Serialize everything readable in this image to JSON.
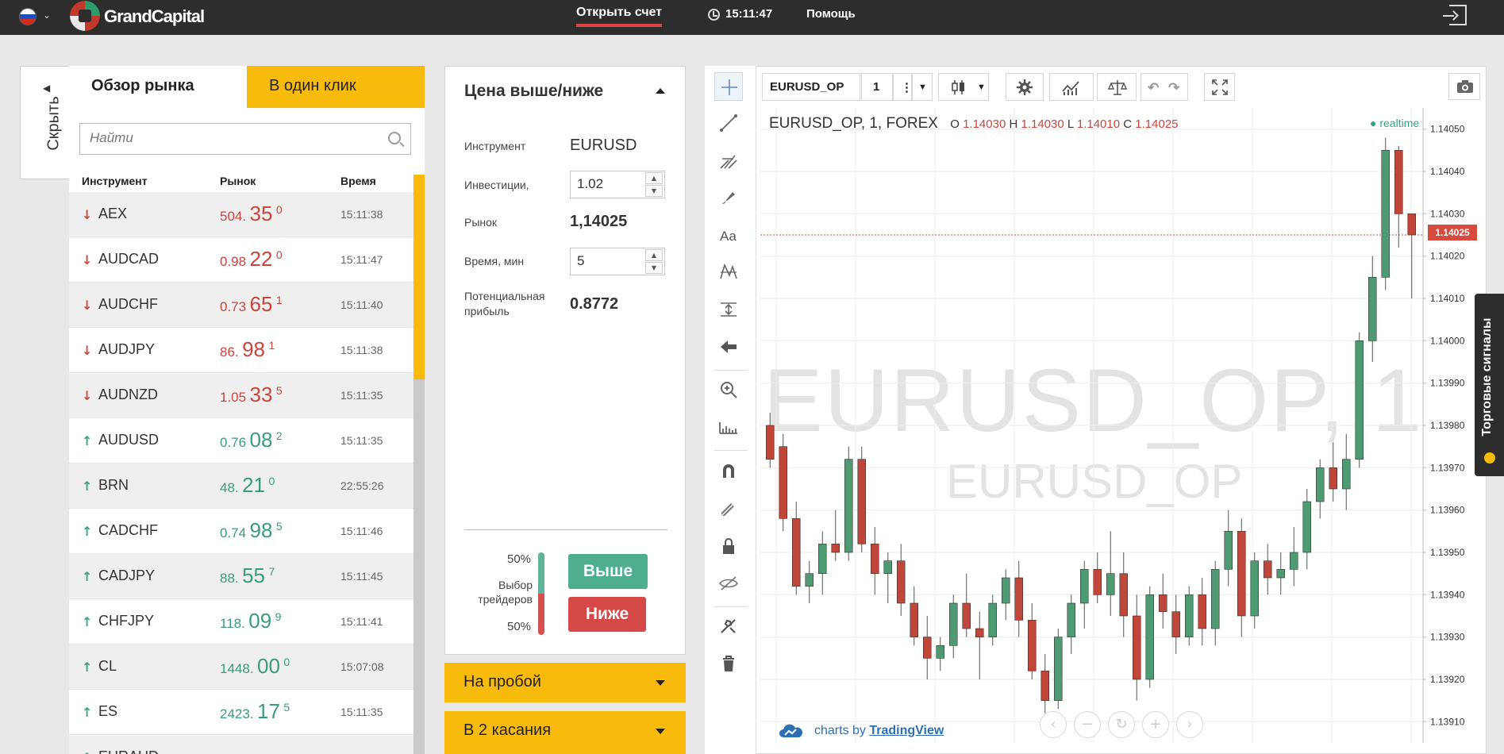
{
  "header": {
    "logo_text": "GrandCapital",
    "open_account": "Открыть счет",
    "time": "15:11:47",
    "help": "Помощь"
  },
  "sidebar_toggle": {
    "label": "Скрыть"
  },
  "market": {
    "tabs": [
      "Обзор рынка",
      "В один клик"
    ],
    "search_placeholder": "Найти",
    "columns": [
      "Инструмент",
      "Рынок",
      "Время"
    ],
    "rows": [
      {
        "symbol": "AEX",
        "dir": "down",
        "p1": "504.",
        "p2": "35",
        "p3": "0",
        "time": "15:11:38"
      },
      {
        "symbol": "AUDCAD",
        "dir": "down",
        "p1": "0.98",
        "p2": "22",
        "p3": "0",
        "time": "15:11:47"
      },
      {
        "symbol": "AUDCHF",
        "dir": "down",
        "p1": "0.73",
        "p2": "65",
        "p3": "1",
        "time": "15:11:40"
      },
      {
        "symbol": "AUDJPY",
        "dir": "down",
        "p1": "86.",
        "p2": "98",
        "p3": "1",
        "time": "15:11:38"
      },
      {
        "symbol": "AUDNZD",
        "dir": "down",
        "p1": "1.05",
        "p2": "33",
        "p3": "5",
        "time": "15:11:35"
      },
      {
        "symbol": "AUDUSD",
        "dir": "up",
        "p1": "0.76",
        "p2": "08",
        "p3": "2",
        "time": "15:11:35"
      },
      {
        "symbol": "BRN",
        "dir": "up",
        "p1": "48.",
        "p2": "21",
        "p3": "0",
        "time": "22:55:26"
      },
      {
        "symbol": "CADCHF",
        "dir": "up",
        "p1": "0.74",
        "p2": "98",
        "p3": "5",
        "time": "15:11:46"
      },
      {
        "symbol": "CADJPY",
        "dir": "up",
        "p1": "88.",
        "p2": "55",
        "p3": "7",
        "time": "15:11:45"
      },
      {
        "symbol": "CHFJPY",
        "dir": "up",
        "p1": "118.",
        "p2": "09",
        "p3": "9",
        "time": "15:11:41"
      },
      {
        "symbol": "CL",
        "dir": "up",
        "p1": "1448.",
        "p2": "00",
        "p3": "0",
        "time": "15:07:08"
      },
      {
        "symbol": "ES",
        "dir": "up",
        "p1": "2423.",
        "p2": "17",
        "p3": "5",
        "time": "15:11:35"
      },
      {
        "symbol": "EURAUD",
        "dir": "up",
        "p1": "",
        "p2": "",
        "p3": "",
        "time": ""
      }
    ]
  },
  "trade": {
    "title": "Цена выше/ниже",
    "instrument_label": "Инструмент",
    "instrument_value": "EURUSD",
    "investment_label": "Инвестиции,",
    "investment_value": "1.02",
    "market_label": "Рынок",
    "market_value": "1,14025",
    "time_label": "Время, мин",
    "time_value": "5",
    "profit_label_1": "Потенциальная",
    "profit_label_2": "прибыль",
    "profit_value": "0.8772",
    "pct_up": "50%",
    "pct_down": "50%",
    "choice_label_1": "Выбор",
    "choice_label_2": "трейдеров",
    "btn_up": "Выше",
    "btn_down": "Ниже"
  },
  "accordions": [
    "На пробой",
    "В 2 касания"
  ],
  "chart": {
    "symbol_box": "EURUSD_OP",
    "interval_box": "1",
    "legend_title": "EURUSD_OP, 1, FOREX",
    "ohlc": {
      "o": "1.14030",
      "h": "1.14030",
      "l": "1.14010",
      "c": "1.14025"
    },
    "realtime": "realtime",
    "watermark_big": "EURUSD_OP, 1",
    "watermark_small": "EURUSD_OP",
    "credit_prefix": "charts by",
    "credit_brand": "TradingView",
    "last_price": "1.14025",
    "y_ticks": [
      "1.14050",
      "1.14040",
      "1.14030",
      "1.14020",
      "1.14010",
      "1.14000",
      "1.13990",
      "1.13980",
      "1.13970",
      "1.13960",
      "1.13950",
      "1.13940",
      "1.13930",
      "1.13920",
      "1.13910"
    ],
    "up_color": "#4e9a73",
    "down_color": "#c0463a"
  },
  "chart_data": {
    "type": "candlestick",
    "series": [
      {
        "name": "EURUSD_OP",
        "values": [
          [
            1.1398,
            1.13983,
            1.1397,
            1.13972
          ],
          [
            1.13975,
            1.13978,
            1.13955,
            1.13958
          ],
          [
            1.13958,
            1.13962,
            1.1394,
            1.13942
          ],
          [
            1.13942,
            1.13948,
            1.13938,
            1.13945
          ],
          [
            1.13945,
            1.13955,
            1.1394,
            1.13952
          ],
          [
            1.13952,
            1.1396,
            1.13948,
            1.1395
          ],
          [
            1.1395,
            1.13975,
            1.13948,
            1.13972
          ],
          [
            1.13972,
            1.13975,
            1.1395,
            1.13952
          ],
          [
            1.13952,
            1.13956,
            1.1394,
            1.13945
          ],
          [
            1.13945,
            1.1395,
            1.13938,
            1.13948
          ],
          [
            1.13948,
            1.13952,
            1.13935,
            1.13938
          ],
          [
            1.13938,
            1.13942,
            1.13928,
            1.1393
          ],
          [
            1.1393,
            1.13935,
            1.1392,
            1.13925
          ],
          [
            1.13925,
            1.1393,
            1.13922,
            1.13928
          ],
          [
            1.13928,
            1.1394,
            1.13925,
            1.13938
          ],
          [
            1.13938,
            1.13945,
            1.1393,
            1.13932
          ],
          [
            1.13932,
            1.13936,
            1.1392,
            1.1393
          ],
          [
            1.1393,
            1.1394,
            1.13928,
            1.13938
          ],
          [
            1.13938,
            1.13946,
            1.13934,
            1.13944
          ],
          [
            1.13944,
            1.13948,
            1.1393,
            1.13934
          ],
          [
            1.13934,
            1.13938,
            1.1392,
            1.13922
          ],
          [
            1.13922,
            1.13926,
            1.13912,
            1.13915
          ],
          [
            1.13915,
            1.13932,
            1.13913,
            1.1393
          ],
          [
            1.1393,
            1.1394,
            1.13926,
            1.13938
          ],
          [
            1.13938,
            1.13948,
            1.13932,
            1.13946
          ],
          [
            1.13946,
            1.1395,
            1.13938,
            1.1394
          ],
          [
            1.1394,
            1.13955,
            1.13935,
            1.13945
          ],
          [
            1.13945,
            1.1395,
            1.1393,
            1.13935
          ],
          [
            1.13935,
            1.1394,
            1.13915,
            1.1392
          ],
          [
            1.1392,
            1.13942,
            1.13918,
            1.1394
          ],
          [
            1.1394,
            1.13945,
            1.13932,
            1.13936
          ],
          [
            1.13936,
            1.1394,
            1.13926,
            1.1393
          ],
          [
            1.1393,
            1.13942,
            1.13928,
            1.1394
          ],
          [
            1.1394,
            1.13944,
            1.13928,
            1.13932
          ],
          [
            1.13932,
            1.13948,
            1.13928,
            1.13946
          ],
          [
            1.13946,
            1.1396,
            1.13942,
            1.13955
          ],
          [
            1.13955,
            1.13958,
            1.1393,
            1.13935
          ],
          [
            1.13935,
            1.1395,
            1.13932,
            1.13948
          ],
          [
            1.13948,
            1.13952,
            1.1394,
            1.13944
          ],
          [
            1.13944,
            1.1395,
            1.1394,
            1.13946
          ],
          [
            1.13946,
            1.13956,
            1.13942,
            1.1395
          ],
          [
            1.1395,
            1.13965,
            1.13946,
            1.13962
          ],
          [
            1.13962,
            1.13972,
            1.13958,
            1.1397
          ],
          [
            1.1397,
            1.13976,
            1.13962,
            1.13965
          ],
          [
            1.13965,
            1.13978,
            1.1396,
            1.13972
          ],
          [
            1.13972,
            1.14002,
            1.1397,
            1.14
          ],
          [
            1.14,
            1.1402,
            1.13995,
            1.14015
          ],
          [
            1.14015,
            1.14048,
            1.14012,
            1.14045
          ],
          [
            1.14045,
            1.14046,
            1.14022,
            1.1403
          ],
          [
            1.1403,
            1.1403,
            1.1401,
            1.14025
          ]
        ]
      }
    ],
    "ylim": [
      1.13905,
      1.14055
    ],
    "y_ticks": [
      1.1405,
      1.1404,
      1.1403,
      1.1402,
      1.1401,
      1.14,
      1.1399,
      1.1398,
      1.1397,
      1.1396,
      1.1395,
      1.1394,
      1.1393,
      1.1392,
      1.1391
    ],
    "grid": true
  }
}
